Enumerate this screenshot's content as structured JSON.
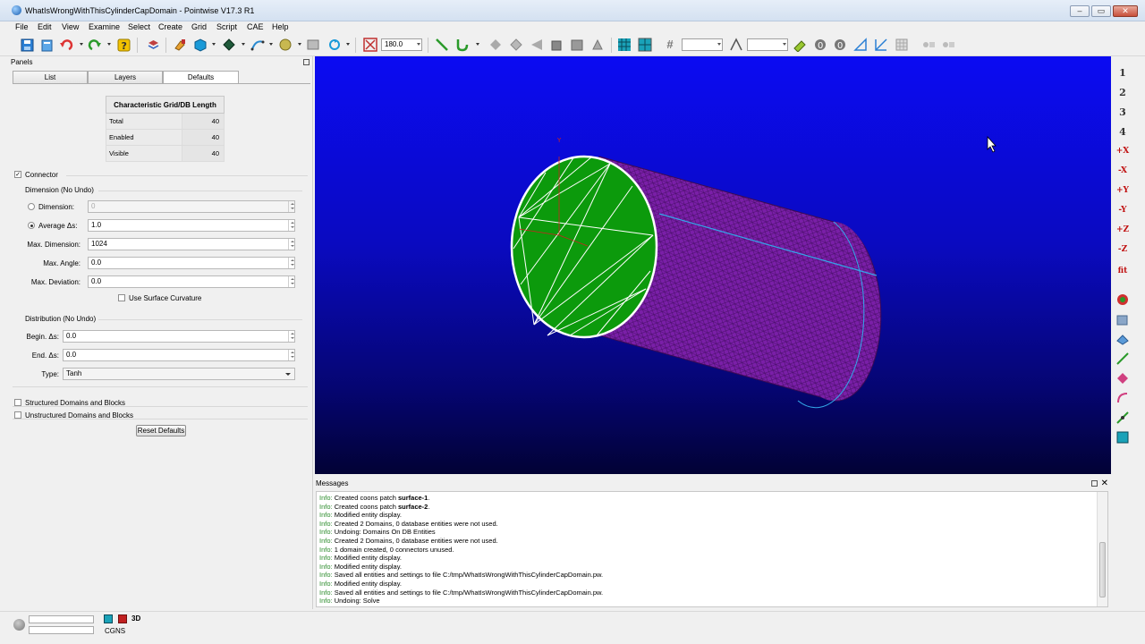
{
  "window": {
    "title": "WhatIsWrongWithThisCylinderCapDomain - Pointwise V17.3 R1",
    "controls": [
      "minimize",
      "maximize",
      "close"
    ]
  },
  "menu": [
    "File",
    "Edit",
    "View",
    "Examine",
    "Select",
    "Create",
    "Grid",
    "Script",
    "CAE",
    "Help"
  ],
  "toolbar": {
    "angle_value": "180.0",
    "icons": [
      "save-icon",
      "open-icon",
      "undo-icon",
      "redo-icon",
      "help-icon",
      "layers-icon",
      "paint-icon",
      "solid-display-icon",
      "render-icon",
      "spline-icon",
      "sphere-icon",
      "image-icon",
      "rotate-icon",
      "angle-icon",
      "connector-icon",
      "curve-icon",
      "domain-icon",
      "block-icon",
      "grid-icon",
      "hash-icon",
      "measure-icon",
      "probe-icon"
    ]
  },
  "panels": {
    "title": "Panels",
    "tabs": [
      "List",
      "Layers",
      "Defaults"
    ],
    "active_tab": "Defaults",
    "cgl_table": {
      "header": "Characteristic Grid/DB Length",
      "rows": [
        {
          "label": "Total",
          "value": "40"
        },
        {
          "label": "Enabled",
          "value": "40"
        },
        {
          "label": "Visible",
          "value": "40"
        }
      ]
    },
    "connector": {
      "label": "Connector",
      "checked": true,
      "dimension_group": "Dimension (No Undo)",
      "dimension_label": "Dimension:",
      "dimension_value": "0",
      "average_label": "Average Δs:",
      "average_value": "1.0",
      "max_dimension_label": "Max. Dimension:",
      "max_dimension_value": "1024",
      "max_angle_label": "Max. Angle:",
      "max_angle_value": "0.0",
      "max_deviation_label": "Max. Deviation:",
      "max_deviation_value": "0.0",
      "use_surface_curvature": "Use Surface Curvature",
      "distribution_group": "Distribution (No Undo)",
      "begin_label": "Begin. Δs:",
      "begin_value": "0.0",
      "end_label": "End. Δs:",
      "end_value": "0.0",
      "type_label": "Type:",
      "type_value": "Tanh"
    },
    "structured": "Structured Domains and Blocks",
    "unstructured": "Unstructured Domains and Blocks",
    "reset_button": "Reset Defaults"
  },
  "view_buttons": [
    "1",
    "2",
    "3",
    "4",
    "+X",
    "-X",
    "+Y",
    "-Y",
    "+Z",
    "-Z",
    "fit"
  ],
  "messages": {
    "title": "Messages",
    "lines": [
      {
        "tag": "Info:",
        "text": "Created coons patch ",
        "bold": "surface-1",
        "tail": "."
      },
      {
        "tag": "Info:",
        "text": "Created coons patch ",
        "bold": "surface-2",
        "tail": "."
      },
      {
        "tag": "Info:",
        "text": "Modified entity display.",
        "bold": "",
        "tail": ""
      },
      {
        "tag": "Info:",
        "text": "Created 2 Domains, 0 database entities were not used.",
        "bold": "",
        "tail": ""
      },
      {
        "tag": "Info:",
        "text": "Undoing: Domains On DB Entities",
        "bold": "",
        "tail": ""
      },
      {
        "tag": "Info:",
        "text": "Created 2 Domains, 0 database entities were not used.",
        "bold": "",
        "tail": ""
      },
      {
        "tag": "Info:",
        "text": "1 domain created, 0 connectors unused.",
        "bold": "",
        "tail": ""
      },
      {
        "tag": "Info:",
        "text": "Modified entity display.",
        "bold": "",
        "tail": ""
      },
      {
        "tag": "Info:",
        "text": "Modified entity display.",
        "bold": "",
        "tail": ""
      },
      {
        "tag": "Info:",
        "text": "Saved all entities and settings to file C:/tmp/WhatIsWrongWithThisCylinderCapDomain.pw.",
        "bold": "",
        "tail": ""
      },
      {
        "tag": "Info:",
        "text": "Modified entity display.",
        "bold": "",
        "tail": ""
      },
      {
        "tag": "Info:",
        "text": "Saved all entities and settings to file C:/tmp/WhatIsWrongWithThisCylinderCapDomain.pw.",
        "bold": "",
        "tail": ""
      },
      {
        "tag": "Info:",
        "text": "Undoing: Solve",
        "bold": "",
        "tail": ""
      }
    ]
  },
  "status": {
    "solver": "CGNS",
    "mode": "3D"
  },
  "colors": {
    "cap": "#0c9a0c",
    "cylinder": "#7a1fa8",
    "viewport_top": "#0b0bf2",
    "viewport_bottom": "#020235"
  }
}
